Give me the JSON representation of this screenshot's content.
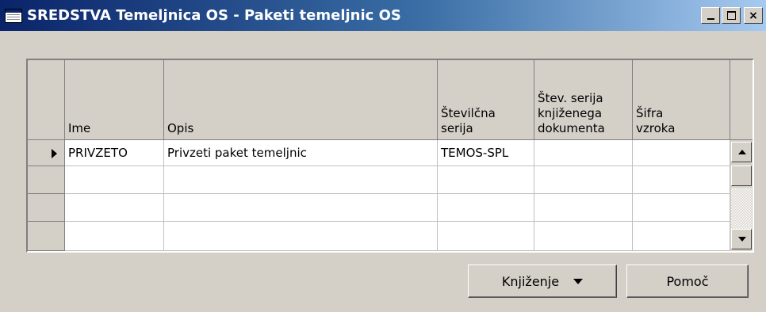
{
  "window": {
    "title": "SREDSTVA Temeljnica OS - Paketi temeljnic OS",
    "icon": "form-icon",
    "controls": [
      "minimize-icon",
      "maximize-icon",
      "close-icon"
    ],
    "close_glyph": "×"
  },
  "table": {
    "columns": [
      {
        "label": "Ime"
      },
      {
        "label": "Opis"
      },
      {
        "label": "Številčna\nserija"
      },
      {
        "label": "Štev. serija\nknjiženega\ndokumenta"
      },
      {
        "label": "Šifra\nvzroka"
      }
    ],
    "rows": [
      {
        "selected": true,
        "cells": [
          "PRIVZETO",
          "Privzeti paket temeljnic",
          "TEMOS-SPL",
          "",
          ""
        ]
      },
      {
        "selected": false,
        "cells": [
          "",
          "",
          "",
          "",
          ""
        ]
      },
      {
        "selected": false,
        "cells": [
          "",
          "",
          "",
          "",
          ""
        ]
      },
      {
        "selected": false,
        "cells": [
          "",
          "",
          "",
          "",
          ""
        ]
      }
    ]
  },
  "buttons": {
    "posting_label": "Knjiženje",
    "help_label": "Pomoč"
  }
}
